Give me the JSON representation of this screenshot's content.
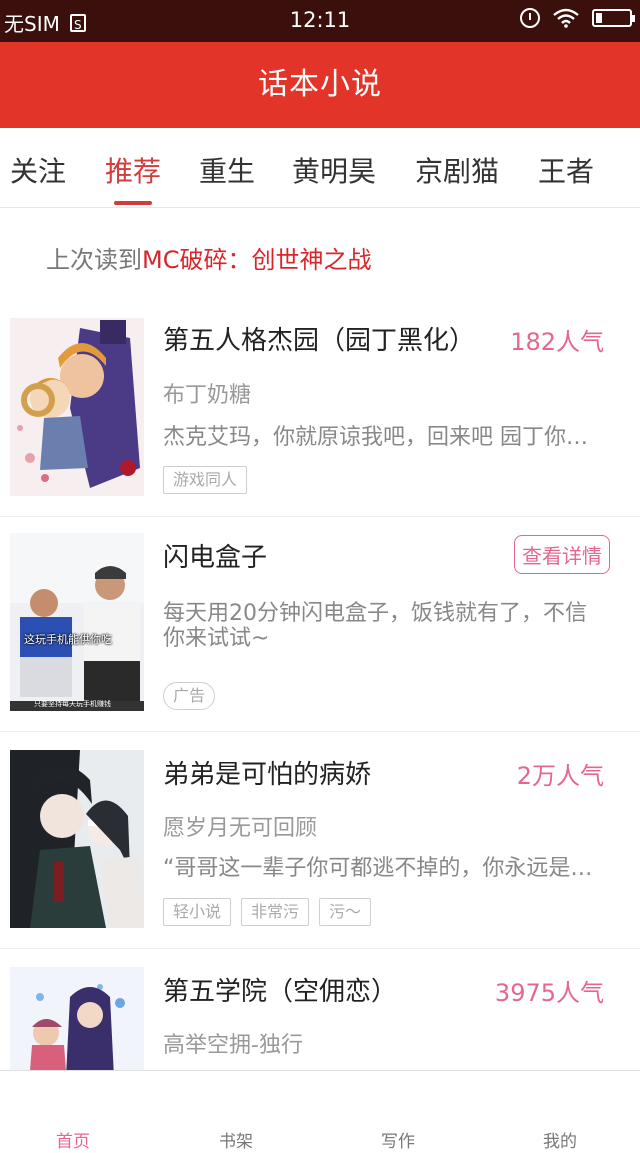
{
  "status_bar": {
    "carrier": "无SIM",
    "sim_badge": "S",
    "time": "12:11"
  },
  "header": {
    "title": "话本小说"
  },
  "tabs": [
    {
      "label": "关注",
      "active": false
    },
    {
      "label": "推荐",
      "active": true
    },
    {
      "label": "重生",
      "active": false
    },
    {
      "label": "黄明昊",
      "active": false
    },
    {
      "label": "京剧猫",
      "active": false
    },
    {
      "label": "王者",
      "active": false
    }
  ],
  "last_read": {
    "prefix": "上次读到",
    "title": "MC破碎：创世神之战"
  },
  "items": [
    {
      "title": "第五人格杰园（园丁黑化）",
      "popularity": "182人气",
      "author": "布丁奶糖",
      "desc": "杰克艾玛，你就原谅我吧，回来吧 园丁你别走，你别丢下我。",
      "tags": [
        "游戏同人"
      ]
    },
    {
      "title": "闪电盒子",
      "action": "查看详情",
      "desc": "每天用20分钟闪电盒子，饭钱就有了，不信你来试试~",
      "tags": [
        "广告"
      ],
      "cover_caption": "这玩手机能供你吃",
      "cover_subcaption": "只要坚持每天玩手机赚钱"
    },
    {
      "title": "弟弟是可怕的病娇",
      "popularity": "2万人气",
      "author": "愿岁月无可回顾",
      "desc": "“哥哥这一辈子你可都逃不掉的，你永远是我的。”",
      "tags": [
        "轻小说",
        "非常污",
        "污～"
      ]
    },
    {
      "title": "第五学院（空佣恋）",
      "popularity": "3975人气",
      "author": "高举空拥-独行"
    }
  ],
  "bottom_nav": [
    {
      "label": "首页",
      "active": true
    },
    {
      "label": "书架",
      "active": false
    },
    {
      "label": "写作",
      "active": false
    },
    {
      "label": "我的",
      "active": false
    }
  ],
  "colors": {
    "brand_red": "#e23428",
    "accent_pink": "#e5678e",
    "status_bg": "#3a0f0c"
  }
}
